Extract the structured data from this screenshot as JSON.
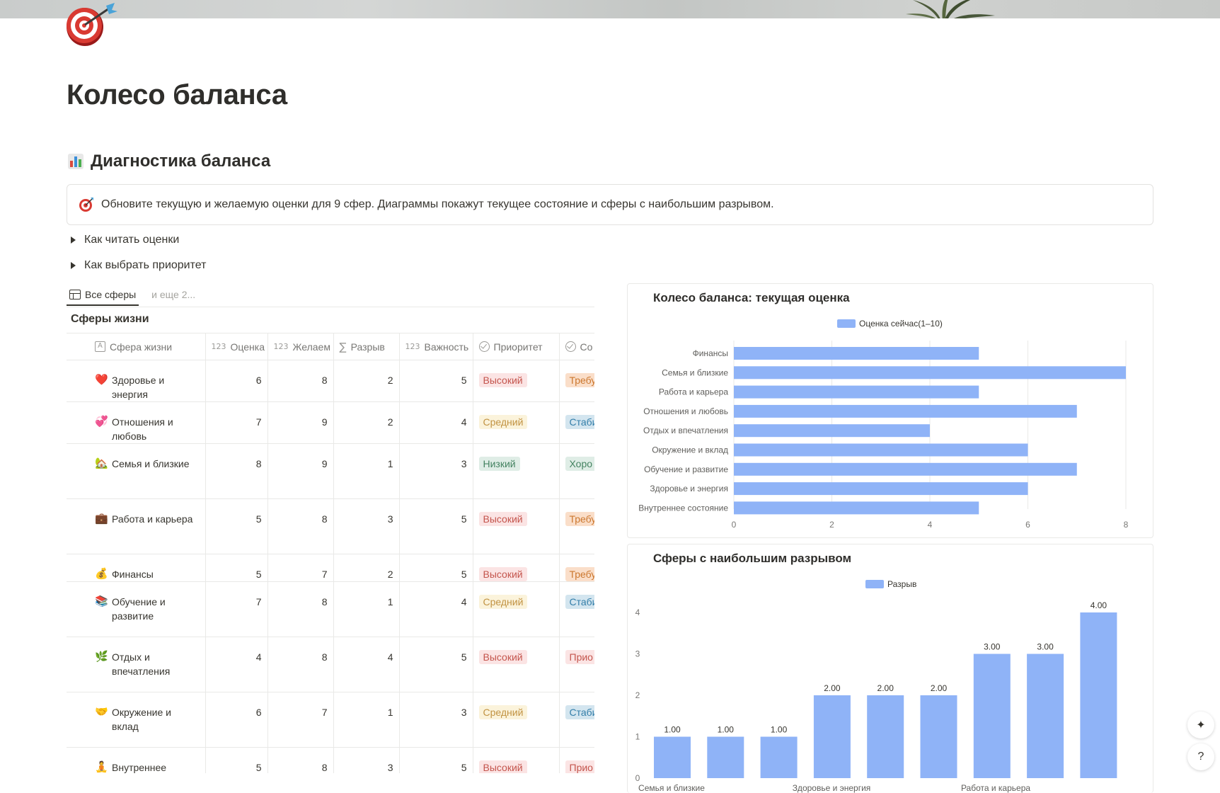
{
  "page": {
    "title": "Колесо баланса",
    "section_title": "Диагностика баланса",
    "callout": "Обновите текущую и желаемую оценки для 9 сфер. Диаграммы покажут текущее состояние и сферы с наибольшим разрывом.",
    "toggles": [
      "Как читать оценки",
      "Как выбрать приоритет"
    ]
  },
  "views": {
    "active": "Все сферы",
    "more": "и еще 2..."
  },
  "database": {
    "title": "Сферы жизни",
    "columns": [
      "Сфера жизни",
      "Оценка",
      "Желаем",
      "Разрыв",
      "Важность",
      "Приоритет",
      "Со"
    ],
    "rows": [
      {
        "emoji": "❤️",
        "name": "Здоровье и энергия",
        "score": "6",
        "desired": "8",
        "gap": "2",
        "importance": "5",
        "priority": "Высокий",
        "priority_color": "red",
        "status": "Требу",
        "status_color": "orange"
      },
      {
        "emoji": "💞",
        "name": "Отношения и любовь",
        "score": "7",
        "desired": "9",
        "gap": "2",
        "importance": "4",
        "priority": "Средний",
        "priority_color": "yellow",
        "status": "Стаби",
        "status_color": "blue"
      },
      {
        "emoji": "🏡",
        "name": "Семья и близкие",
        "score": "8",
        "desired": "9",
        "gap": "1",
        "importance": "3",
        "priority": "Низкий",
        "priority_color": "green",
        "status": "Хоро",
        "status_color": "green"
      },
      {
        "emoji": "💼",
        "name": "Работа и карьера",
        "score": "5",
        "desired": "8",
        "gap": "3",
        "importance": "5",
        "priority": "Высокий",
        "priority_color": "red",
        "status": "Требу",
        "status_color": "orange"
      },
      {
        "emoji": "💰",
        "name": "Финансы",
        "score": "5",
        "desired": "7",
        "gap": "2",
        "importance": "5",
        "priority": "Высокий",
        "priority_color": "red",
        "status": "Требу",
        "status_color": "orange"
      },
      {
        "emoji": "📚",
        "name": "Обучение и развитие",
        "score": "7",
        "desired": "8",
        "gap": "1",
        "importance": "4",
        "priority": "Средний",
        "priority_color": "yellow",
        "status": "Стаби",
        "status_color": "blue"
      },
      {
        "emoji": "🌿",
        "name": "Отдых и впечатления",
        "score": "4",
        "desired": "8",
        "gap": "4",
        "importance": "5",
        "priority": "Высокий",
        "priority_color": "red",
        "status": "Прио",
        "status_color": "red"
      },
      {
        "emoji": "🤝",
        "name": "Окружение и вклад",
        "score": "6",
        "desired": "7",
        "gap": "1",
        "importance": "3",
        "priority": "Средний",
        "priority_color": "yellow",
        "status": "Стаби",
        "status_color": "blue"
      },
      {
        "emoji": "🧘",
        "name": "Внутреннее состояние",
        "score": "5",
        "desired": "8",
        "gap": "3",
        "importance": "5",
        "priority": "Высокий",
        "priority_color": "red",
        "status": "Прио",
        "status_color": "red"
      }
    ]
  },
  "colors": {
    "bar": "#8fb3f7"
  },
  "chart_data": [
    {
      "type": "bar",
      "orientation": "horizontal",
      "title": "Колесо баланса: текущая оценка",
      "series": [
        {
          "name": "Оценка сейчас(1–10)",
          "values": [
            5,
            8,
            5,
            7,
            4,
            6,
            7,
            6,
            5
          ]
        }
      ],
      "categories": [
        "Финансы",
        "Семья и близкие",
        "Работа и карьера",
        "Отношения и любовь",
        "Отдых и впечатления",
        "Окружение и вклад",
        "Обучение и развитие",
        "Здоровье и энергия",
        "Внутреннее состояние"
      ],
      "xlim": [
        0,
        8
      ],
      "ticks": [
        "0",
        "2",
        "4",
        "6",
        "8"
      ],
      "grid": true,
      "legend": "top-center"
    },
    {
      "type": "bar",
      "orientation": "vertical",
      "title": "Сферы с наибольшим разрывом",
      "series": [
        {
          "name": "Разрыв",
          "values": [
            1,
            1,
            1,
            2,
            2,
            2,
            3,
            3,
            4
          ]
        }
      ],
      "data_labels": [
        "1.00",
        "1.00",
        "1.00",
        "2.00",
        "2.00",
        "2.00",
        "3.00",
        "3.00",
        "4.00"
      ],
      "visible_category_labels": [
        "Семья и близкие",
        "Здоровье и энергия",
        "Работа и карьера"
      ],
      "ylim": [
        0,
        4
      ],
      "ticks": [
        "0",
        "1",
        "2",
        "3",
        "4"
      ],
      "legend": "top-center"
    }
  ]
}
